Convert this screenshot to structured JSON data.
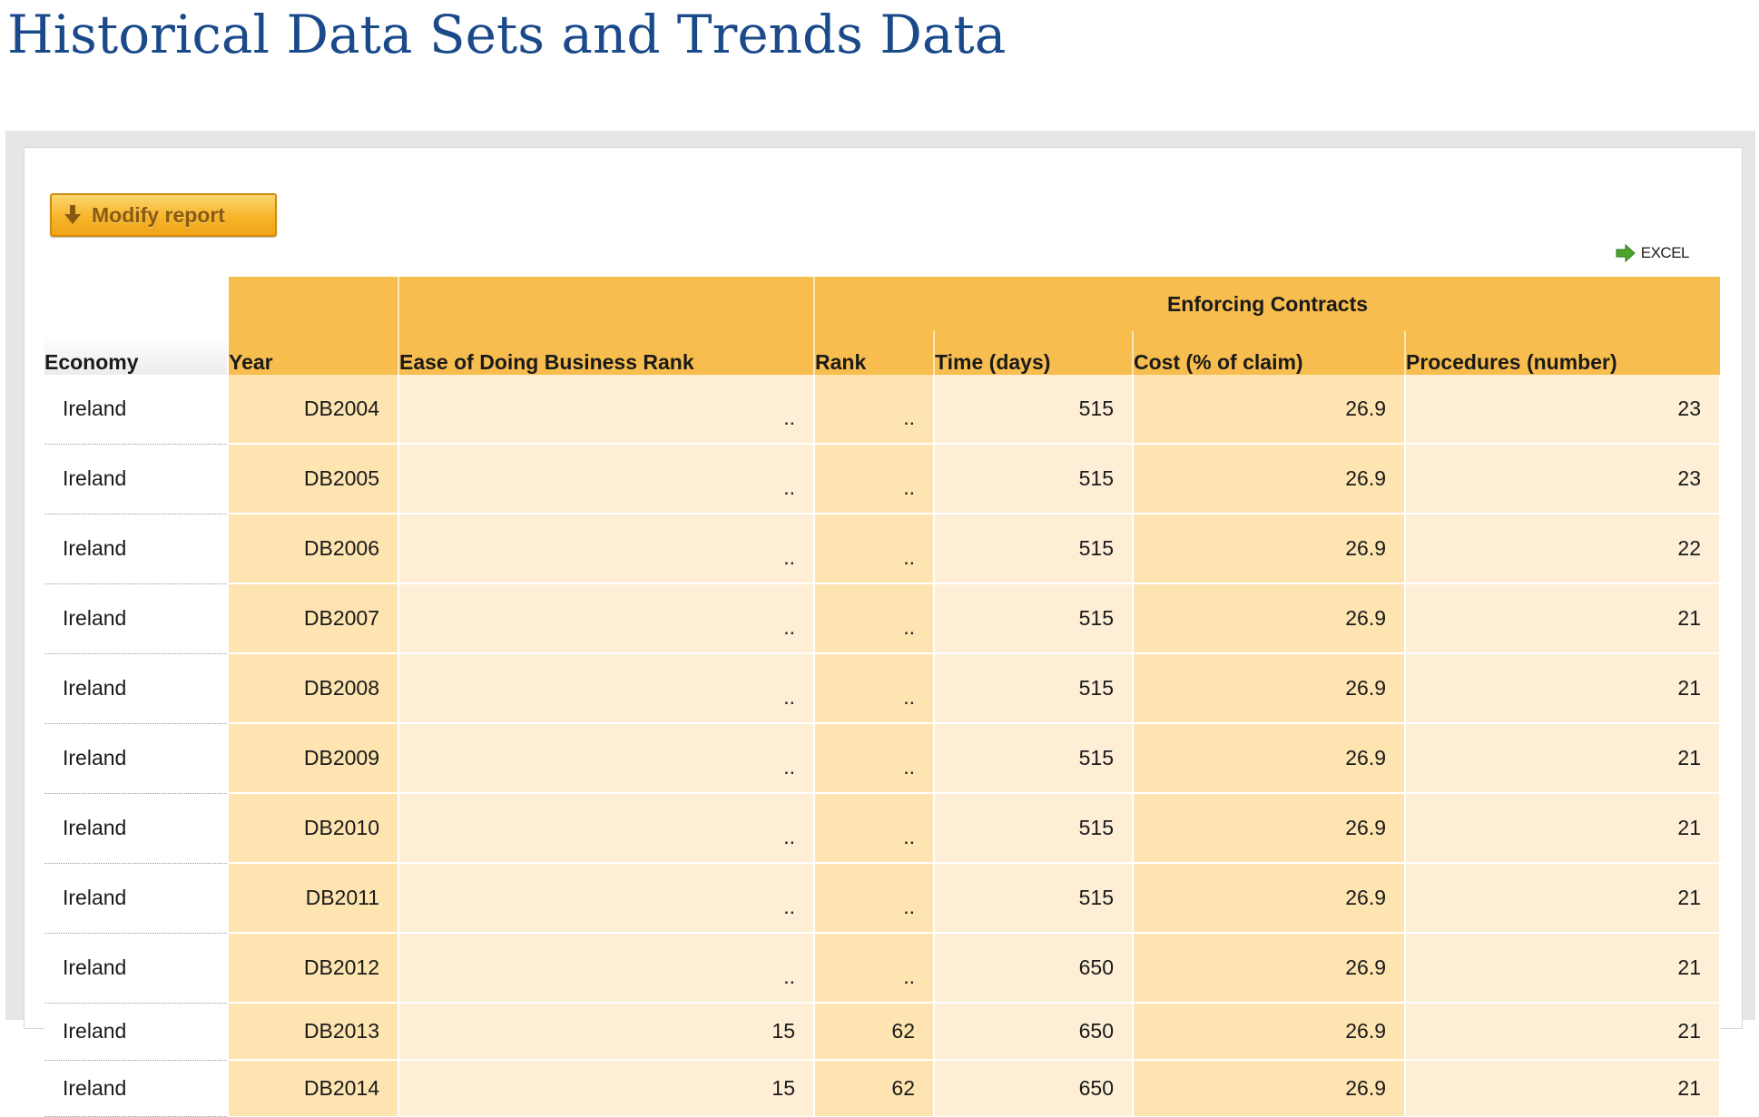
{
  "page": {
    "title": "Historical Data Sets and Trends Data"
  },
  "toolbar": {
    "modify_label": "Modify report",
    "excel_label": "EXCEL"
  },
  "colors": {
    "title": "#1a4a8a",
    "header": "#f7bd4e",
    "cell_dark": "#fde4b1",
    "cell_light": "#feeed6",
    "button": "#f6b52a"
  },
  "table": {
    "group_header": "Enforcing Contracts",
    "columns": {
      "economy": "Economy",
      "year": "Year",
      "ease_rank": "Ease of Doing Business Rank",
      "rank": "Rank",
      "time": "Time (days)",
      "cost": "Cost (% of claim)",
      "procedures": "Procedures (number)"
    },
    "rows": [
      {
        "economy": "Ireland",
        "year": "DB2004",
        "ease_rank": "..",
        "rank": "..",
        "time": "515",
        "cost": "26.9",
        "procedures": "23"
      },
      {
        "economy": "Ireland",
        "year": "DB2005",
        "ease_rank": "..",
        "rank": "..",
        "time": "515",
        "cost": "26.9",
        "procedures": "23"
      },
      {
        "economy": "Ireland",
        "year": "DB2006",
        "ease_rank": "..",
        "rank": "..",
        "time": "515",
        "cost": "26.9",
        "procedures": "22"
      },
      {
        "economy": "Ireland",
        "year": "DB2007",
        "ease_rank": "..",
        "rank": "..",
        "time": "515",
        "cost": "26.9",
        "procedures": "21"
      },
      {
        "economy": "Ireland",
        "year": "DB2008",
        "ease_rank": "..",
        "rank": "..",
        "time": "515",
        "cost": "26.9",
        "procedures": "21"
      },
      {
        "economy": "Ireland",
        "year": "DB2009",
        "ease_rank": "..",
        "rank": "..",
        "time": "515",
        "cost": "26.9",
        "procedures": "21"
      },
      {
        "economy": "Ireland",
        "year": "DB2010",
        "ease_rank": "..",
        "rank": "..",
        "time": "515",
        "cost": "26.9",
        "procedures": "21"
      },
      {
        "economy": "Ireland",
        "year": "DB2011",
        "ease_rank": "..",
        "rank": "..",
        "time": "515",
        "cost": "26.9",
        "procedures": "21"
      },
      {
        "economy": "Ireland",
        "year": "DB2012",
        "ease_rank": "..",
        "rank": "..",
        "time": "650",
        "cost": "26.9",
        "procedures": "21"
      },
      {
        "economy": "Ireland",
        "year": "DB2013",
        "ease_rank": "15",
        "rank": "62",
        "time": "650",
        "cost": "26.9",
        "procedures": "21"
      },
      {
        "economy": "Ireland",
        "year": "DB2014",
        "ease_rank": "15",
        "rank": "62",
        "time": "650",
        "cost": "26.9",
        "procedures": "21"
      }
    ]
  }
}
